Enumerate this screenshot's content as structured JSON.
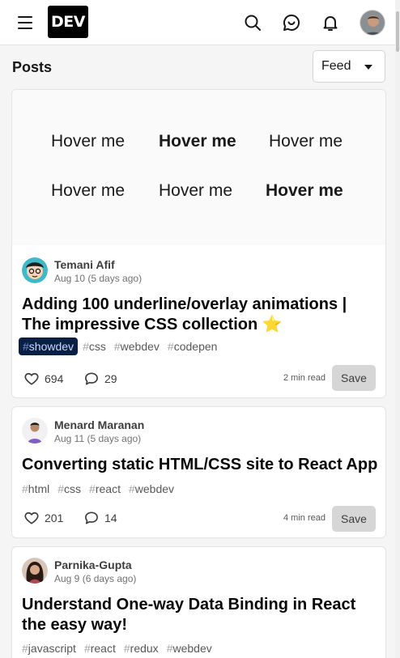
{
  "header": {
    "logo_text": "DEV",
    "icons": [
      "menu-icon",
      "search-icon",
      "chat-icon",
      "bell-icon",
      "user-avatar"
    ]
  },
  "page": {
    "section_title": "Posts",
    "feed_select": {
      "selected": "Feed"
    }
  },
  "colors": {
    "showdev_tag_bg": "#0a1f44",
    "save_button_bg": "#d6d6d7",
    "page_bg": "#f5f5f5"
  },
  "posts": [
    {
      "cover": {
        "cells": [
          "Hover me",
          "Hover me",
          "Hover me",
          "Hover me",
          "Hover me",
          "Hover me"
        ],
        "bold_cells": [
          1,
          5
        ]
      },
      "author": "Temani Afif",
      "date": "Aug 10 (5 days ago)",
      "title": "Adding 100 underline/overlay animations | The impressive CSS collection ⭐",
      "tags": [
        {
          "name": "showdev",
          "highlight": true
        },
        {
          "name": "css"
        },
        {
          "name": "webdev"
        },
        {
          "name": "codepen"
        }
      ],
      "reactions": "694",
      "comments": "29",
      "read_time": "2 min read",
      "save_label": "Save"
    },
    {
      "author": "Menard Maranan",
      "date": "Aug 11 (5 days ago)",
      "title": "Converting static HTML/CSS site to React App",
      "tags": [
        {
          "name": "html"
        },
        {
          "name": "css"
        },
        {
          "name": "react"
        },
        {
          "name": "webdev"
        }
      ],
      "reactions": "201",
      "comments": "14",
      "read_time": "4 min read",
      "save_label": "Save"
    },
    {
      "author": "Parnika-Gupta",
      "date": "Aug 9 (6 days ago)",
      "title": "Understand One-way Data Binding in React the easy way!",
      "tags": [
        {
          "name": "javascript"
        },
        {
          "name": "react"
        },
        {
          "name": "redux"
        },
        {
          "name": "webdev"
        }
      ]
    }
  ]
}
